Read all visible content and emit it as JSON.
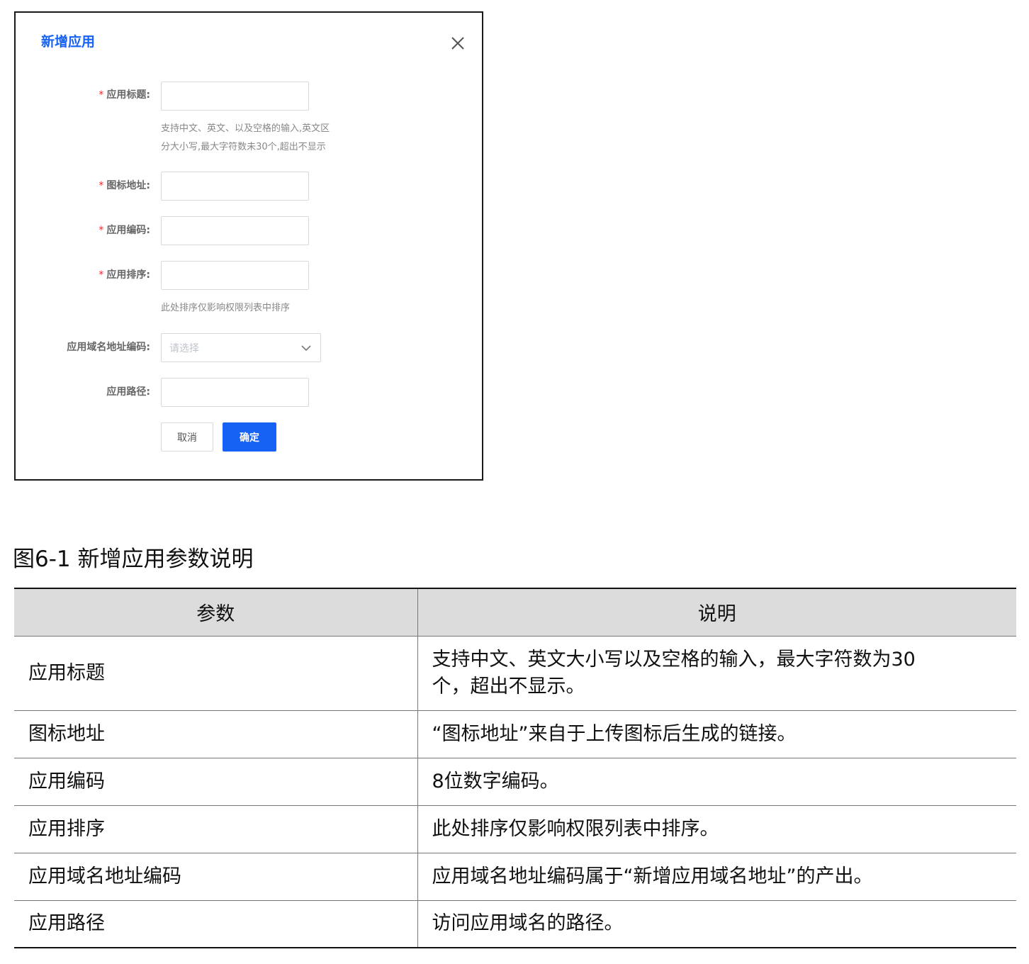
{
  "dialog": {
    "title": "新增应用",
    "close_icon": "close-icon",
    "fields": {
      "app_title": {
        "label": "应用标题:",
        "required_mark": "*",
        "value": ""
      },
      "app_title_hint_line1": "支持中文、英文、以及空格的输入,英文区",
      "app_title_hint_line2": "分大小写,最大字符数未30个,超出不显示",
      "icon_url": {
        "label": "图标地址:",
        "required_mark": "*",
        "value": ""
      },
      "app_code": {
        "label": "应用编码:",
        "required_mark": "*",
        "value": ""
      },
      "app_order": {
        "label": "应用排序:",
        "required_mark": "*",
        "value": ""
      },
      "app_order_hint": "此处排序仅影响权限列表中排序",
      "domain_code": {
        "label": "应用域名地址编码:",
        "placeholder": "请选择"
      },
      "app_path": {
        "label": "应用路径:",
        "value": ""
      }
    },
    "buttons": {
      "cancel": "取消",
      "ok": "确定"
    }
  },
  "caption": "图6-1 新增应用参数说明",
  "table": {
    "headers": [
      "参数",
      "说明"
    ],
    "rows": [
      {
        "param": "应用标题",
        "desc_line1": "支持中文、英文大小写以及空格的输入，最大字符数为30",
        "desc_line2": "个，超出不显示。"
      },
      {
        "param": "图标地址",
        "desc": "“图标地址”来自于上传图标后生成的链接。"
      },
      {
        "param": "应用编码",
        "desc": "8位数字编码。"
      },
      {
        "param": "应用排序",
        "desc": "此处排序仅影响权限列表中排序。"
      },
      {
        "param": "应用域名地址编码",
        "desc": "应用域名地址编码属于“新增应用域名地址”的产出。"
      },
      {
        "param": "应用路径",
        "desc": "访问应用域名的路径。"
      }
    ]
  }
}
